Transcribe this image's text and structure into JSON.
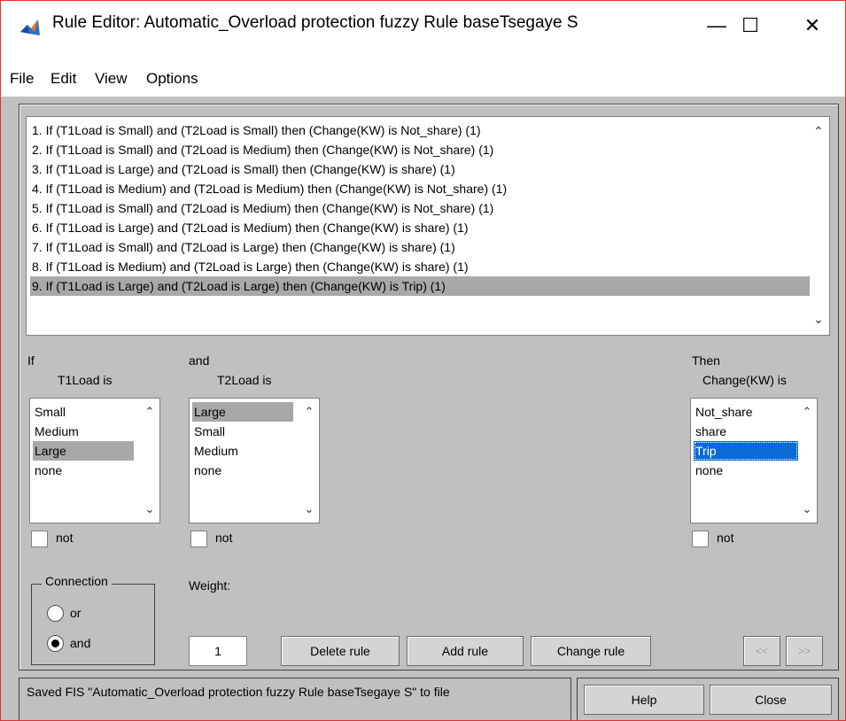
{
  "window": {
    "title": "Rule Editor: Automatic_Overload protection  fuzzy Rule baseTsegaye S",
    "minimize_glyph": "—",
    "maximize_glyph": "☐",
    "close_glyph": "✕"
  },
  "menu": [
    "File",
    "Edit",
    "View",
    "Options"
  ],
  "rules": [
    "1. If (T1Load is Small) and (T2Load is Small) then (Change(KW) is Not_share) (1)",
    "2. If (T1Load is Small) and (T2Load is Medium) then (Change(KW) is Not_share) (1)",
    "3. If (T1Load is Large) and (T2Load is Small) then (Change(KW) is share) (1)",
    "4. If (T1Load is Medium) and (T2Load is Medium) then (Change(KW) is Not_share) (1)",
    "5. If (T1Load is Small) and (T2Load is Medium) then (Change(KW) is Not_share) (1)",
    "6. If (T1Load is Large) and (T2Load is Medium) then (Change(KW) is share) (1)",
    "7. If (T1Load is Small) and (T2Load is Large) then (Change(KW) is share) (1)",
    "8. If (T1Load is Medium) and (T2Load is Large) then (Change(KW) is share) (1)",
    "9. If (T1Load is Large) and (T2Load is Large) then (Change(KW) is Trip) (1)"
  ],
  "selected_rule_index": 8,
  "scroll_up_glyph": "⌃",
  "scroll_down_glyph": "⌄",
  "antecedent1": {
    "prefix": "If",
    "label": "T1Load is",
    "options": [
      "Small",
      "Medium",
      "Large",
      "none"
    ],
    "selected": "Large",
    "not_label": "not"
  },
  "antecedent2": {
    "prefix": "and",
    "label": "T2Load is",
    "options": [
      "Large",
      "Small",
      "Medium",
      "none"
    ],
    "selected": "Large",
    "not_label": "not"
  },
  "consequent": {
    "prefix": "Then",
    "label": "Change(KW) is",
    "options": [
      "Not_share",
      "share",
      "Trip",
      "none"
    ],
    "selected": "Trip",
    "not_label": "not"
  },
  "connection": {
    "title": "Connection",
    "or_label": "or",
    "and_label": "and",
    "selected": "and"
  },
  "weight": {
    "label": "Weight:",
    "value": "1"
  },
  "buttons": {
    "delete_rule": "Delete rule",
    "add_rule": "Add rule",
    "change_rule": "Change rule",
    "prev": "<<",
    "next": ">>",
    "help": "Help",
    "close": "Close"
  },
  "status": "Saved FIS \"Automatic_Overload protection  fuzzy Rule baseTsegaye S\" to file"
}
